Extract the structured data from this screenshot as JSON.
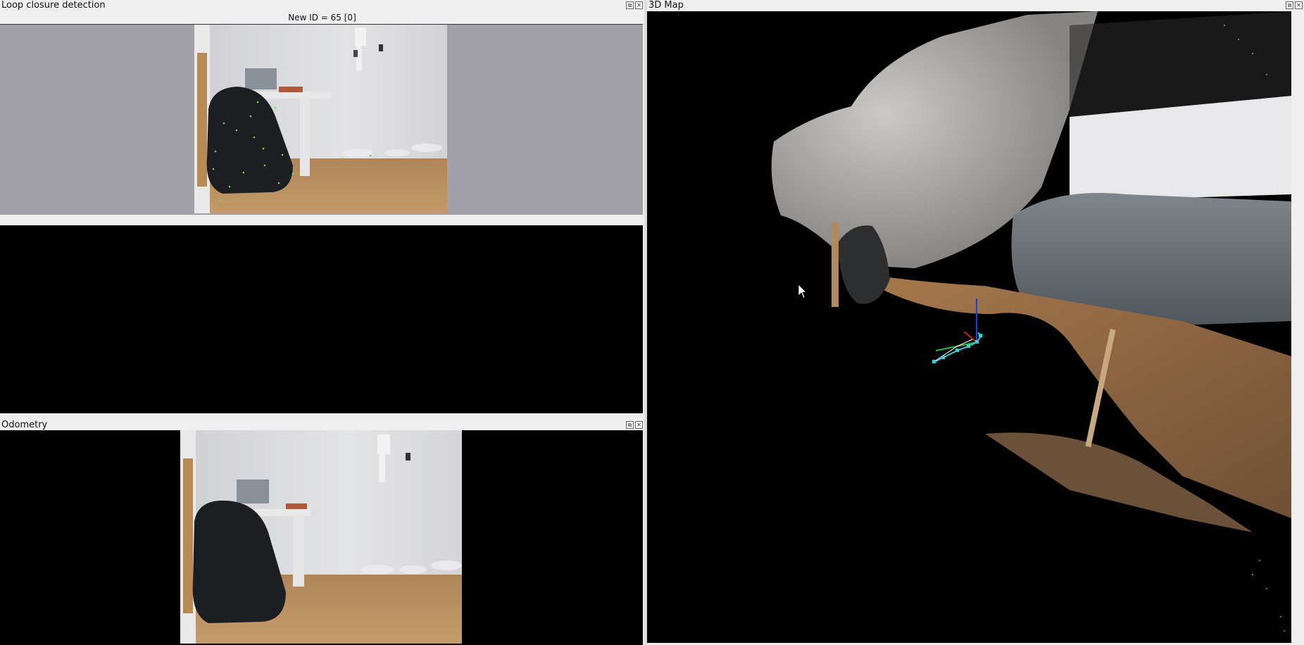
{
  "loop_panel": {
    "title": "Loop closure detection",
    "subtitle": "New ID = 65 [0]"
  },
  "odometry_panel": {
    "title": "Odometry"
  },
  "map_panel": {
    "title": "3D Map"
  },
  "dock_buttons": {
    "float_glyph": "⧉",
    "close_glyph": "✕"
  },
  "colors": {
    "view_gray": "#a2a1a7",
    "trajectory": "#22d6e0",
    "axis_x": "#d42020",
    "axis_y": "#20c030",
    "axis_z": "#2040e0"
  }
}
